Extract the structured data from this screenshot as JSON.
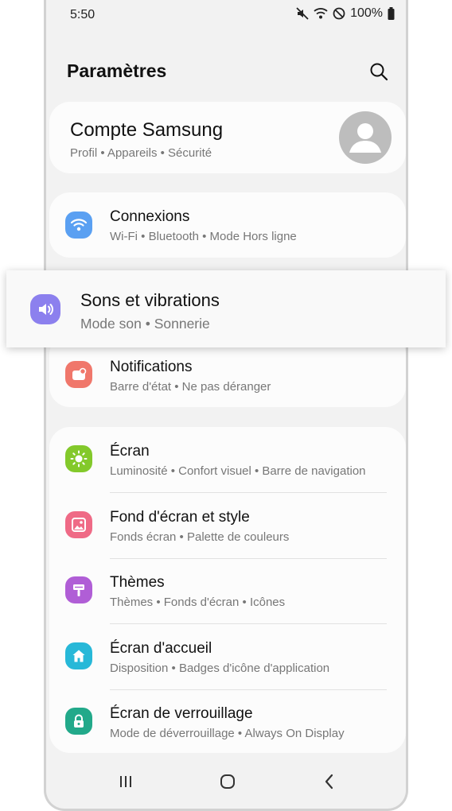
{
  "status": {
    "time": "5:50",
    "battery": "100%"
  },
  "header": {
    "title": "Paramètres"
  },
  "account": {
    "title": "Compte Samsung",
    "subtitle": "Profil • Appareils • Sécurité"
  },
  "connexions": {
    "title": "Connexions",
    "subtitle": "Wi-Fi • Bluetooth • Mode Hors ligne",
    "color": "#5aa0f2"
  },
  "sons": {
    "title": "Sons et vibrations",
    "subtitle": "Mode son • Sonnerie",
    "color": "#8c80ee"
  },
  "notifications": {
    "title": "Notifications",
    "subtitle": "Barre d'état • Ne pas déranger",
    "color": "#f0776b"
  },
  "display_items": [
    {
      "title": "Écran",
      "subtitle": "Luminosité • Confort visuel • Barre de navigation",
      "color": "#83c92b",
      "icon": "sun-icon"
    },
    {
      "title": "Fond d'écran et style",
      "subtitle": "Fonds écran • Palette de couleurs",
      "color": "#ef6a86",
      "icon": "wallpaper-icon"
    },
    {
      "title": "Thèmes",
      "subtitle": "Thèmes • Fonds d'écran • Icônes",
      "color": "#b05ed6",
      "icon": "brush-icon"
    },
    {
      "title": "Écran d'accueil",
      "subtitle": "Disposition • Badges d'icône d'application",
      "color": "#27b8d8",
      "icon": "home-icon"
    },
    {
      "title": "Écran de verrouillage",
      "subtitle": "Mode de déverrouillage • Always On Display",
      "color": "#22a98a",
      "icon": "lock-icon"
    }
  ]
}
